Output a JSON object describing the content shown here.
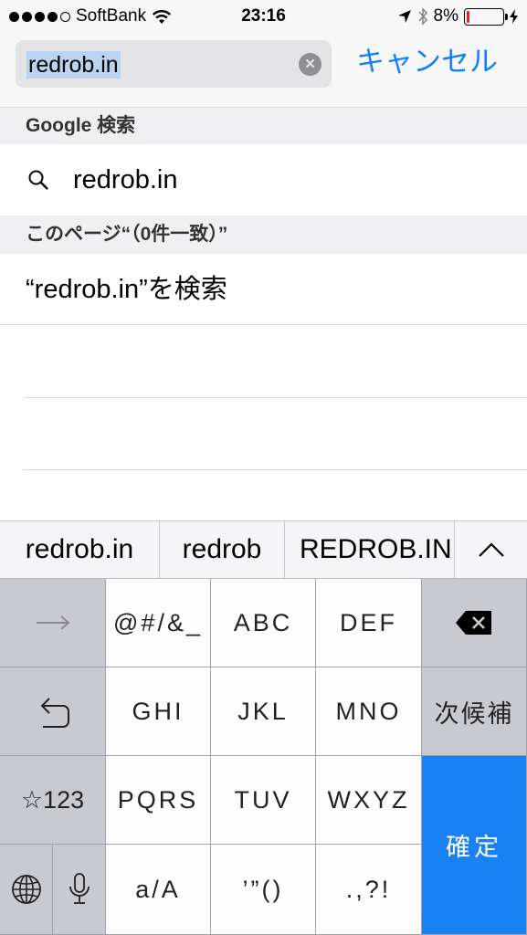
{
  "status": {
    "carrier": "SoftBank",
    "time": "23:16",
    "battery": "8%",
    "battery_level": 0.08,
    "signal_bars_filled": 4,
    "signal_bars_total": 5
  },
  "search": {
    "value": "redrob.in",
    "cancel_label": "キャンセル"
  },
  "sections": {
    "google_header": "Google 検索",
    "google_suggestion": "redrob.in",
    "page_header": "このページ“（0件一致）”",
    "page_find": "“redrob.in”を検索"
  },
  "predictive": {
    "items": [
      "redrob.in",
      "redrob",
      "REDROB.IN"
    ]
  },
  "keyboard": {
    "row1": [
      "@#/&_",
      "ABC",
      "DEF"
    ],
    "row2": [
      "GHI",
      "JKL",
      "MNO"
    ],
    "row3": [
      "PQRS",
      "TUV",
      "WXYZ"
    ],
    "row4": [
      "a/A",
      "’”()",
      ".,?!"
    ],
    "next_candidate": "次候補",
    "confirm": "確定",
    "num_toggle": "☆123"
  },
  "colors": {
    "accent": "#147efb",
    "confirm_key": "#1a81f5",
    "battery_low": "#e0242c"
  }
}
